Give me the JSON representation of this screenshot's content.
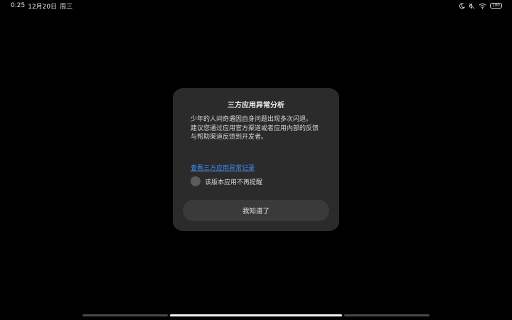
{
  "status_bar": {
    "time": "0:25",
    "date": "12月20日",
    "weekday": "周三",
    "battery": "100",
    "icons": [
      "moon-icon",
      "mute-icon",
      "wifi-icon",
      "battery-icon"
    ]
  },
  "dialog": {
    "title": "三方应用异常分析",
    "message_lines": [
      "少年的人间奇遇因自身问题出现多次闪退。",
      "建议您通过应用官方渠道或者应用内部的反馈与帮助渠道反馈到开发者。"
    ],
    "link_text": "查看三方应用异常记录",
    "checkbox_label": "该版本应用不再提醒",
    "checkbox_checked": false,
    "confirm_label": "我知道了"
  },
  "colors": {
    "background": "#000000",
    "dialog_bg": "#2b2b2b",
    "button_bg": "#3a3a3a",
    "link": "#3f8ff0"
  }
}
